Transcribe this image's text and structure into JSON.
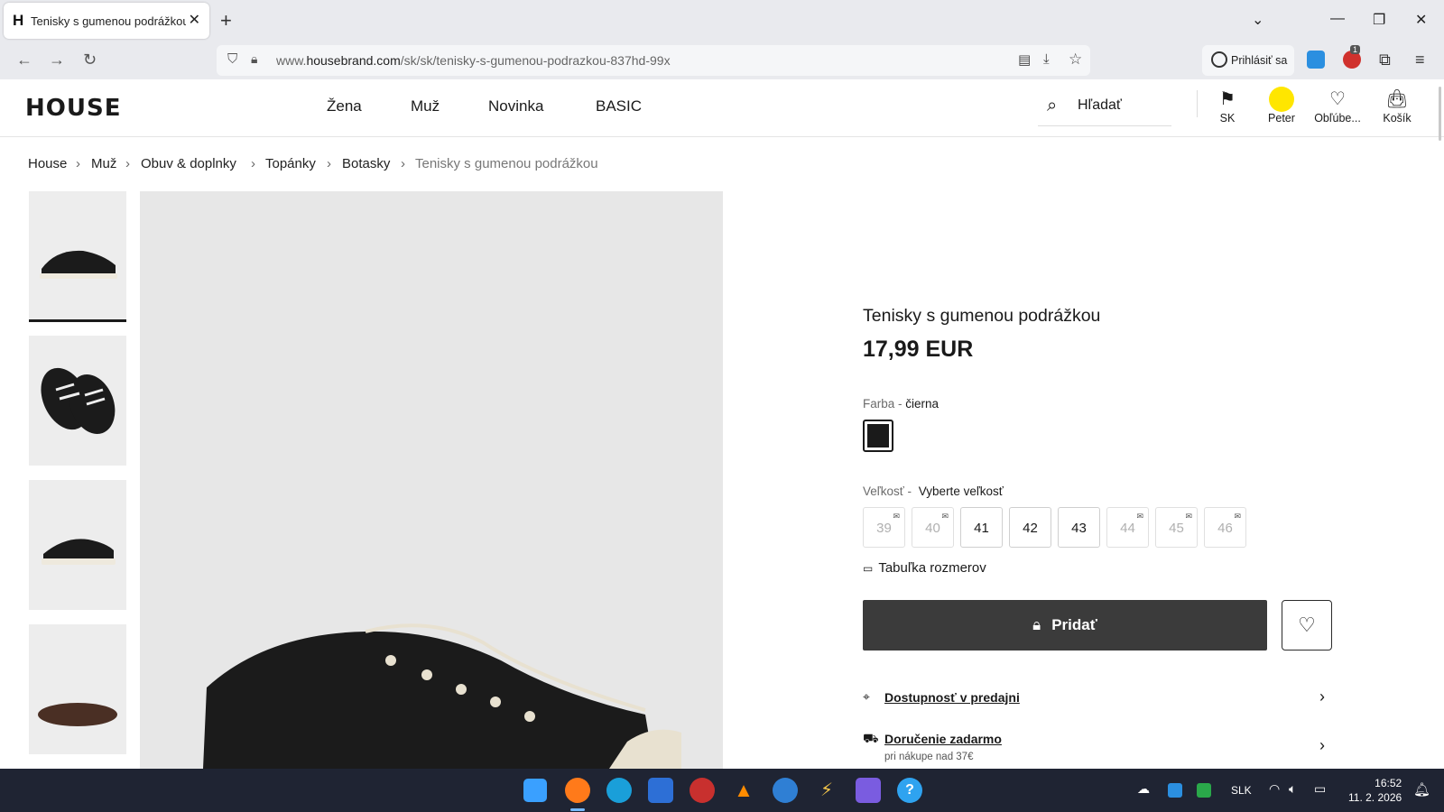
{
  "browser": {
    "tab_favicon": "H",
    "tab_title": "Tenisky s gumenou podrážkou |",
    "url_prefix": "www.",
    "url_domain": "housebrand.com",
    "url_path": "/sk/sk/tenisky-s-gumenou-podrazkou-837hd-99x",
    "signin_label": "Prihlásiť sa",
    "extension_badge": "1"
  },
  "site": {
    "logo": "HOUSE",
    "nav": [
      "Žena",
      "Muž",
      "Novinka",
      "BASIC"
    ],
    "search_label": "Hľadať",
    "header_items": [
      {
        "icon": "flag-icon",
        "label": "SK"
      },
      {
        "icon": "user-icon",
        "label": "Peter"
      },
      {
        "icon": "heart-icon",
        "label": "Obľúbe..."
      },
      {
        "icon": "bag-icon",
        "label": "Košík"
      }
    ]
  },
  "breadcrumb": [
    "House",
    "Muž",
    "Obuv & doplnky",
    "Topánky",
    "Botasky",
    "Tenisky s gumenou podrážkou"
  ],
  "product": {
    "title": "Tenisky s gumenou podrážkou",
    "price": "17,99 EUR",
    "color_label": "Farba -",
    "color_value": "čierna",
    "color_hex": "#1a1a1a",
    "size_label": "Veľkosť -",
    "size_prompt": "Vyberte veľkosť",
    "sizes": [
      {
        "label": "39",
        "available": false
      },
      {
        "label": "40",
        "available": false
      },
      {
        "label": "41",
        "available": true
      },
      {
        "label": "42",
        "available": true
      },
      {
        "label": "43",
        "available": true
      },
      {
        "label": "44",
        "available": false
      },
      {
        "label": "45",
        "available": false
      },
      {
        "label": "46",
        "available": false
      }
    ],
    "size_chart_label": "Tabuľka rozmerov",
    "add_button_label": "Pridať",
    "store_availability_label": "Dostupnosť v predajni",
    "free_delivery_label": "Doručenie zadarmo",
    "free_delivery_note": "pri nákupe nad 37€"
  },
  "taskbar": {
    "language": "SLK",
    "time": "16:52",
    "date": "11. 2. 2026"
  }
}
